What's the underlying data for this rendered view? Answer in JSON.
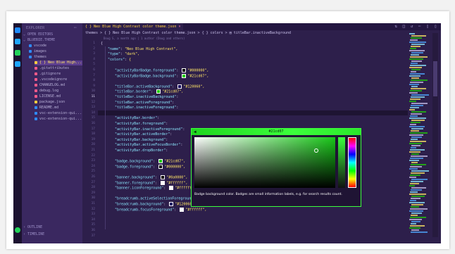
{
  "window": {
    "title": "Neo Blue High Contrast color theme.json"
  },
  "sidebar": {
    "title": "EXPLORER",
    "sections": [
      "OPEN EDITORS",
      "BLUEBIE.THEME"
    ],
    "items": [
      {
        "label": "vscode",
        "color": "#2f8bff"
      },
      {
        "label": "images",
        "color": "#2f8bff"
      },
      {
        "label": "themes",
        "color": "#2f8bff"
      },
      {
        "label": "{ } Neo Blue High...",
        "color": "#ffcf3f",
        "selected": true
      },
      {
        "label": ".gitattributes",
        "color": "#ff5a8a"
      },
      {
        "label": ".gitignore",
        "color": "#ff5a8a"
      },
      {
        "label": ".vscodeignore",
        "color": "#ff5a8a"
      },
      {
        "label": "CHANGELOG.md",
        "color": "#ff5a8a"
      },
      {
        "label": "debug.log",
        "color": "#ff5a8a"
      },
      {
        "label": "LICENSE.md",
        "color": "#ff5a8a"
      },
      {
        "label": "package.json",
        "color": "#ffcf3f"
      },
      {
        "label": "README.md",
        "color": "#2f8bff"
      },
      {
        "label": "vsc-extension-qui...",
        "color": "#2f8bff"
      },
      {
        "label": "vsc-extension-qui...",
        "color": "#2f8bff"
      }
    ],
    "bottom_sections": [
      "OUTLINE",
      "TIMELINE"
    ]
  },
  "tab": {
    "label": "{ } Neo Blue High Contrast color theme.json",
    "close": "×"
  },
  "breadcrumb": "themes > { } Neo Blue High Contrast color theme.json > { } colors > ▤ titleBar.inactiveBackground",
  "codelens": "Doug S, a month ago | 1 author (Doug and others)",
  "gutter": {
    "line_numbers": [
      "1",
      "2",
      "3",
      "4",
      "5",
      "6",
      "7",
      "8",
      "9",
      "10",
      "11",
      "12",
      "13",
      "14",
      "15",
      "16",
      "17",
      "18",
      "19",
      "20",
      "21",
      "22",
      "23",
      "24",
      "25",
      "26",
      "27",
      "28",
      "29",
      "30",
      "31",
      "32",
      "33",
      "34",
      "35",
      "36",
      "37"
    ],
    "current_line": "11"
  },
  "code": [
    {
      "t": "{"
    },
    {
      "k": "\"name\"",
      "v": "\"Neo Blue High Contrast\","
    },
    {
      "k": "\"type\"",
      "v": "\"dark\","
    },
    {
      "k": "\"colors\"",
      "v": "{"
    },
    {
      "t": ""
    },
    {
      "k": "\"activityBarBadge.foreground\"",
      "v": "\"#000000\",",
      "sw": "#000000"
    },
    {
      "k": "\"activityBarBadge.background\"",
      "v": "\"#21cd07\",",
      "sw": "#21cd07"
    },
    {
      "t": ""
    },
    {
      "k": "\"titleBar.activeBackground\"",
      "v": "\"#120060\",",
      "sw": "#120060"
    },
    {
      "k": "\"titleBar.border\"",
      "v": "\"#21cd07\",",
      "sw": "#21cd07"
    },
    {
      "k": "\"titleBar.inactiveBackground\"",
      "v": ""
    },
    {
      "k": "\"titleBar.activeForeground\"",
      "v": ""
    },
    {
      "k": "\"titleBar.inactiveForeground\"",
      "v": ""
    },
    {
      "t": ""
    },
    {
      "k": "\"activityBar.border\"",
      "v": ""
    },
    {
      "k": "\"activityBar.foreground\"",
      "v": ""
    },
    {
      "k": "\"activityBar.inactiveForeground\"",
      "v": ""
    },
    {
      "k": "\"activityBar.activeBorder\"",
      "v": ""
    },
    {
      "k": "\"activityBar.background\"",
      "v": ""
    },
    {
      "k": "\"activityBar.activeFocusBorder\"",
      "v": ""
    },
    {
      "k": "\"activityBar.dropBorder\"",
      "v": ""
    },
    {
      "t": ""
    },
    {
      "k": "\"badge.background\"",
      "v": "\"#21cd07\",",
      "sw": "#21cd07"
    },
    {
      "k": "\"badge.foreground\"",
      "v": "\"#000000\",",
      "sw": "#000000"
    },
    {
      "t": ""
    },
    {
      "k": "\"banner.background\"",
      "v": "\"#0a0000\",",
      "sw": "#0a0000"
    },
    {
      "k": "\"banner.foreground\"",
      "v": "\"#ffffff\",",
      "sw": "#ffffff"
    },
    {
      "k": "\"banner.iconForeground\"",
      "v": "\"#ffffff\",",
      "sw": "#ffffff"
    },
    {
      "t": ""
    },
    {
      "k": "\"breadcrumb.activeSelectionForeground\"",
      "v": "\"#21cd07\",",
      "sw": "#21cd07"
    },
    {
      "k": "\"breadcrumb.background\"",
      "v": "\"#120060\",",
      "sw": "#120060"
    },
    {
      "k": "\"breadcrumb.focusForeground\"",
      "v": "\"#ffffff\",",
      "sw": "#ffffff"
    }
  ],
  "color_picker": {
    "value": "#21cd07",
    "description": "Badge background color. Badges are small information labels, e.g. for search results count."
  },
  "colors": {
    "accent": "#3cff3c",
    "key": "#8ce8ff",
    "string": "#ffe566"
  }
}
